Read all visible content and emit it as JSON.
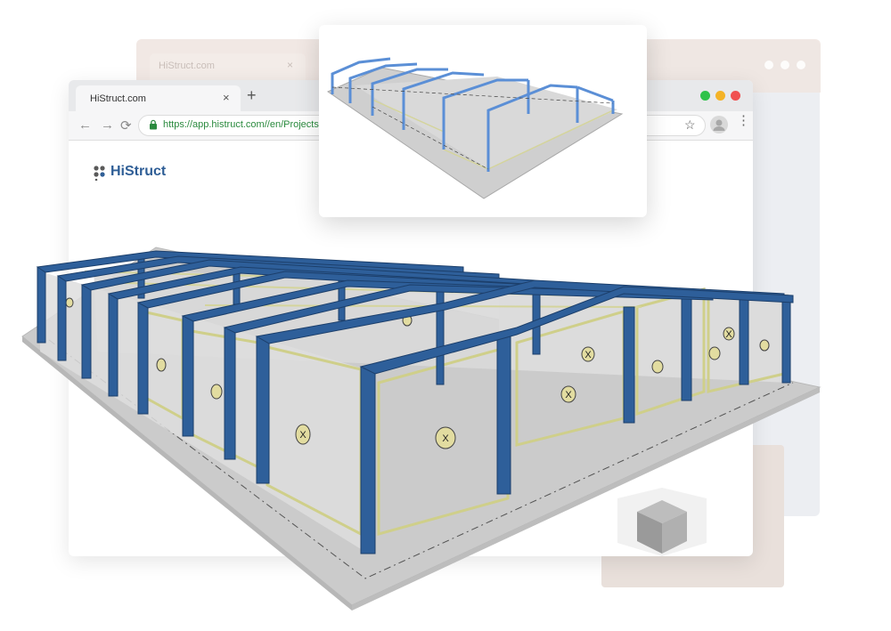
{
  "back_browser": {
    "tab_title": "HiStruct.com",
    "tab_close": "×"
  },
  "browser": {
    "tab_title": "HiStruct.com",
    "tab_close": "×",
    "new_tab": "+",
    "window_controls": {
      "green": "#2fc24a",
      "yellow": "#f4b327",
      "red": "#f05050"
    },
    "nav": {
      "back": "←",
      "forward": "→",
      "reload": "⟳"
    },
    "url": "https://app.histruct.com//en/Projects",
    "bookmark_star": "☆",
    "menu_dots": "⋮"
  },
  "app": {
    "logo_text": "HiStruct",
    "brand_color": "#2f5e96"
  },
  "model": {
    "frame_color": "#2e5f9a",
    "bracing_color": "#cfcf8a",
    "floor_color": "#c9c9c9",
    "wall_color": "#d8d8d8",
    "bracing_marker": "X"
  },
  "icons": {
    "lock": "lock-icon",
    "star": "star-icon",
    "profile": "profile-icon",
    "view_cube": "view-cube-icon"
  }
}
